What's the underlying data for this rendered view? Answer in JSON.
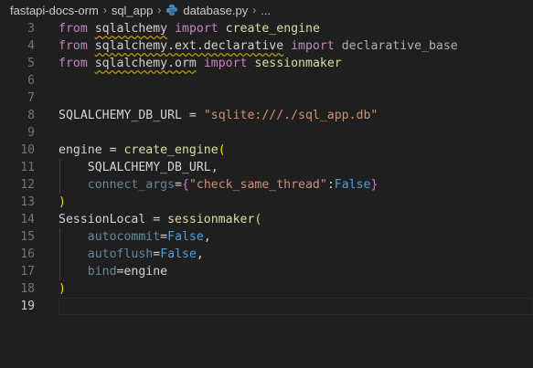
{
  "breadcrumb": {
    "items": [
      "fastapi-docs-orm",
      "sql_app",
      "database.py",
      "..."
    ]
  },
  "editor": {
    "lines": [
      {
        "n": "3"
      },
      {
        "n": "4"
      },
      {
        "n": "5"
      },
      {
        "n": "6"
      },
      {
        "n": "7"
      },
      {
        "n": "8"
      },
      {
        "n": "9"
      },
      {
        "n": "10"
      },
      {
        "n": "11"
      },
      {
        "n": "12"
      },
      {
        "n": "13"
      },
      {
        "n": "14"
      },
      {
        "n": "15"
      },
      {
        "n": "16"
      },
      {
        "n": "17"
      },
      {
        "n": "18"
      },
      {
        "n": "19"
      }
    ],
    "active_line": "19"
  },
  "code": {
    "from": "from",
    "import": "import",
    "sqlalchemy": "sqlalchemy",
    "sqlalchemy_ext_declarative": "sqlalchemy.ext.declarative",
    "sqlalchemy_orm": "sqlalchemy.orm",
    "create_engine": "create_engine",
    "declarative_base": "declarative_base",
    "sessionmaker": "sessionmaker",
    "db_url_name": "SQLALCHEMY_DB_URL",
    "eq": " = ",
    "db_url_value": "\"sqlite:///./sql_app.db\"",
    "engine": "engine",
    "open_paren": "(",
    "close_paren": ")",
    "comma": ",",
    "connect_args": "connect_args",
    "eq_noSpace": "=",
    "open_brace": "{",
    "close_brace": "}",
    "check_same_thread": "\"check_same_thread\"",
    "colon": ":",
    "false": "False",
    "session_local": "SessionLocal",
    "autocommit": "autocommit",
    "autoflush": "autoflush",
    "bind": "bind"
  },
  "colors": {
    "background": "#1f1f1f",
    "keyword": "#569cd6",
    "control_keyword": "#c586c0",
    "function": "#dcdcaa",
    "string": "#ce9178",
    "variable": "#9cdcfe",
    "bracket_gold": "#ffd700",
    "bracket_pink": "#da70d6",
    "python_icon": "#3572a5"
  }
}
